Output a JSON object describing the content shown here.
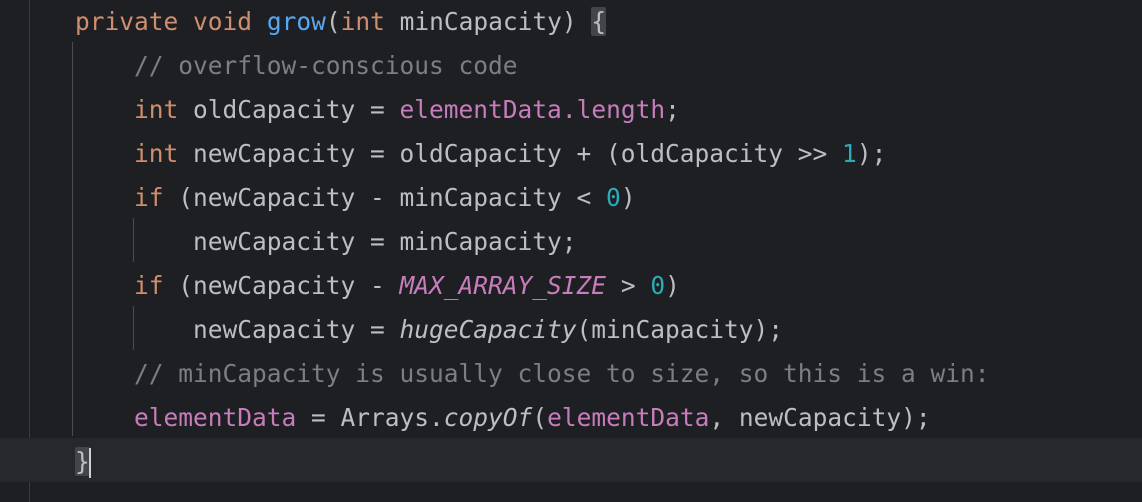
{
  "editor": {
    "lines": [
      {
        "tokens": [
          {
            "t": "private",
            "c": "kw"
          },
          {
            "t": " "
          },
          {
            "t": "void",
            "c": "kw"
          },
          {
            "t": " "
          },
          {
            "t": "grow",
            "c": "fn"
          },
          {
            "t": "("
          },
          {
            "t": "int",
            "c": "kw"
          },
          {
            "t": " minCapacity) "
          },
          {
            "t": "{",
            "c": "brace-hl"
          }
        ]
      },
      {
        "tokens": [
          {
            "t": "    "
          },
          {
            "t": "// overflow-conscious code",
            "c": "cmt"
          }
        ]
      },
      {
        "tokens": [
          {
            "t": "    "
          },
          {
            "t": "int",
            "c": "kw"
          },
          {
            "t": " oldCapacity = "
          },
          {
            "t": "elementData",
            "c": "fld"
          },
          {
            "t": ".length",
            "c": "fld"
          },
          {
            "t": ";"
          }
        ]
      },
      {
        "tokens": [
          {
            "t": "    "
          },
          {
            "t": "int",
            "c": "kw"
          },
          {
            "t": " newCapacity = oldCapacity + (oldCapacity >> "
          },
          {
            "t": "1",
            "c": "num"
          },
          {
            "t": ");"
          }
        ]
      },
      {
        "tokens": [
          {
            "t": "    "
          },
          {
            "t": "if",
            "c": "kw"
          },
          {
            "t": " (newCapacity - minCapacity < "
          },
          {
            "t": "0",
            "c": "num"
          },
          {
            "t": ")"
          }
        ]
      },
      {
        "tokens": [
          {
            "t": "        newCapacity = minCapacity;"
          }
        ]
      },
      {
        "tokens": [
          {
            "t": "    "
          },
          {
            "t": "if",
            "c": "kw"
          },
          {
            "t": " (newCapacity - "
          },
          {
            "t": "MAX_ARRAY_SIZE",
            "c": "const"
          },
          {
            "t": " > "
          },
          {
            "t": "0",
            "c": "num"
          },
          {
            "t": ")"
          }
        ]
      },
      {
        "tokens": [
          {
            "t": "        newCapacity = "
          },
          {
            "t": "hugeCapacity",
            "c": "static-call"
          },
          {
            "t": "(minCapacity);"
          }
        ]
      },
      {
        "tokens": [
          {
            "t": "    "
          },
          {
            "t": "// minCapacity is usually close to size, so this is a win:",
            "c": "cmt"
          }
        ]
      },
      {
        "tokens": [
          {
            "t": "    "
          },
          {
            "t": "elementData",
            "c": "fld"
          },
          {
            "t": " = Arrays."
          },
          {
            "t": "copyOf",
            "c": "static-call"
          },
          {
            "t": "("
          },
          {
            "t": "elementData",
            "c": "fld"
          },
          {
            "t": ", newCapacity);"
          }
        ]
      },
      {
        "tokens": [
          {
            "t": "}",
            "c": "brace-hl"
          },
          {
            "cursor": true
          }
        ]
      }
    ]
  }
}
